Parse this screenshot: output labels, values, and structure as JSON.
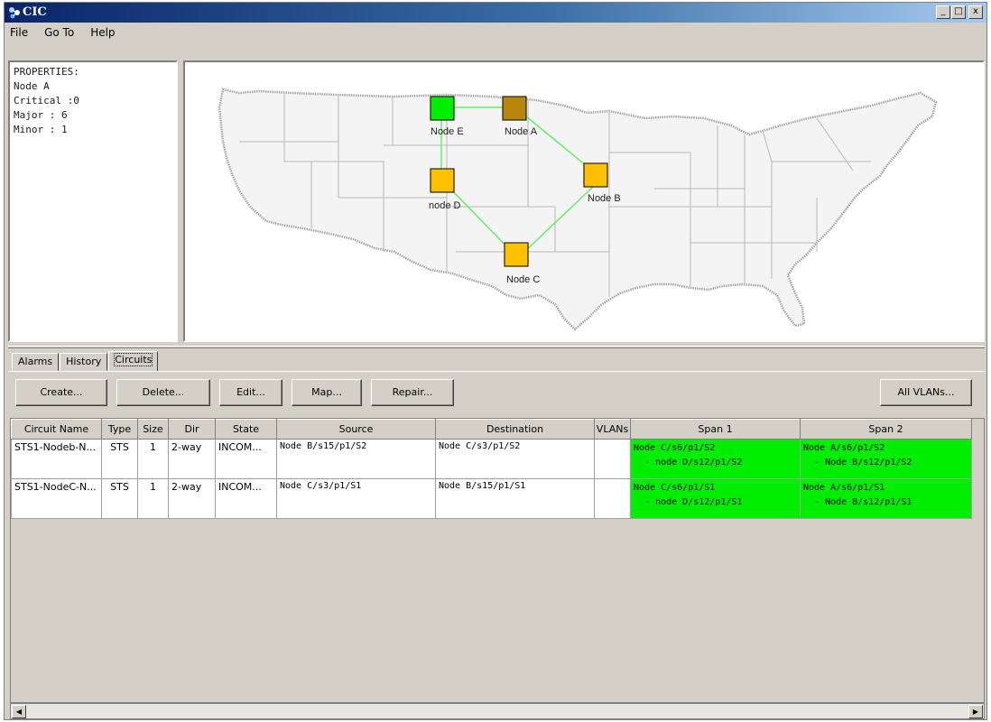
{
  "window": {
    "title": "CIC"
  },
  "winbuttons": {
    "minimize": "_",
    "maximize": "□",
    "close": "x"
  },
  "menu": {
    "items": [
      "File",
      "Go To",
      "Help"
    ]
  },
  "properties": {
    "lines": [
      "PROPERTIES:",
      "Node A",
      "Critical :0",
      "Major : 6",
      "Minor : 1"
    ]
  },
  "map": {
    "nodes": [
      {
        "id": "node-e",
        "label": "Node E",
        "color": "#00ee00"
      },
      {
        "id": "node-a",
        "label": "Node A",
        "color": "#b8860b"
      },
      {
        "id": "node-d",
        "label": "node D",
        "color": "#ffc000"
      },
      {
        "id": "node-b",
        "label": "Node B",
        "color": "#ffc000"
      },
      {
        "id": "node-c",
        "label": "Node C",
        "color": "#ffc000"
      }
    ],
    "link_color": "#66ee66"
  },
  "tabs": {
    "items": [
      "Alarms",
      "History",
      "Circuits"
    ],
    "active": "Circuits"
  },
  "toolbar": {
    "create": "Create...",
    "delete": "Delete...",
    "edit": "Edit...",
    "map": "Map...",
    "repair": "Repair...",
    "all_vlans": "All VLANs..."
  },
  "circuits": {
    "columns": [
      "Circuit Name",
      "Type",
      "Size",
      "Dir",
      "State",
      "Source",
      "Destination",
      "VLANs",
      "Span 1",
      "Span 2"
    ],
    "rows": [
      {
        "name": "STS1-Nodeb-N...",
        "type": "STS",
        "size": "1",
        "dir": "2-way",
        "state": "INCOM...",
        "source": "Node B/s15/p1/S2",
        "destination": "Node C/s3/p1/S2",
        "vlans": "",
        "span1_a": "Node C/s6/p1/S2",
        "span1_b": "  - node D/s12/p1/S2",
        "span2_a": "Node A/s6/p1/S2",
        "span2_b": "  - Node B/s12/p1/S2"
      },
      {
        "name": "STS1-NodeC-N...",
        "type": "STS",
        "size": "1",
        "dir": "2-way",
        "state": "INCOM...",
        "source": "Node C/s3/p1/S1",
        "destination": "Node B/s15/p1/S1",
        "vlans": "",
        "span1_a": "Node C/s6/p1/S1",
        "span1_b": "  - node D/s12/p1/S1",
        "span2_a": "Node A/s6/p1/S1",
        "span2_b": "  - Node B/s12/p1/S1"
      }
    ],
    "span_color": "#00ee00"
  },
  "scrollbar": {
    "left_arrow": "◀",
    "right_arrow": "▶"
  }
}
